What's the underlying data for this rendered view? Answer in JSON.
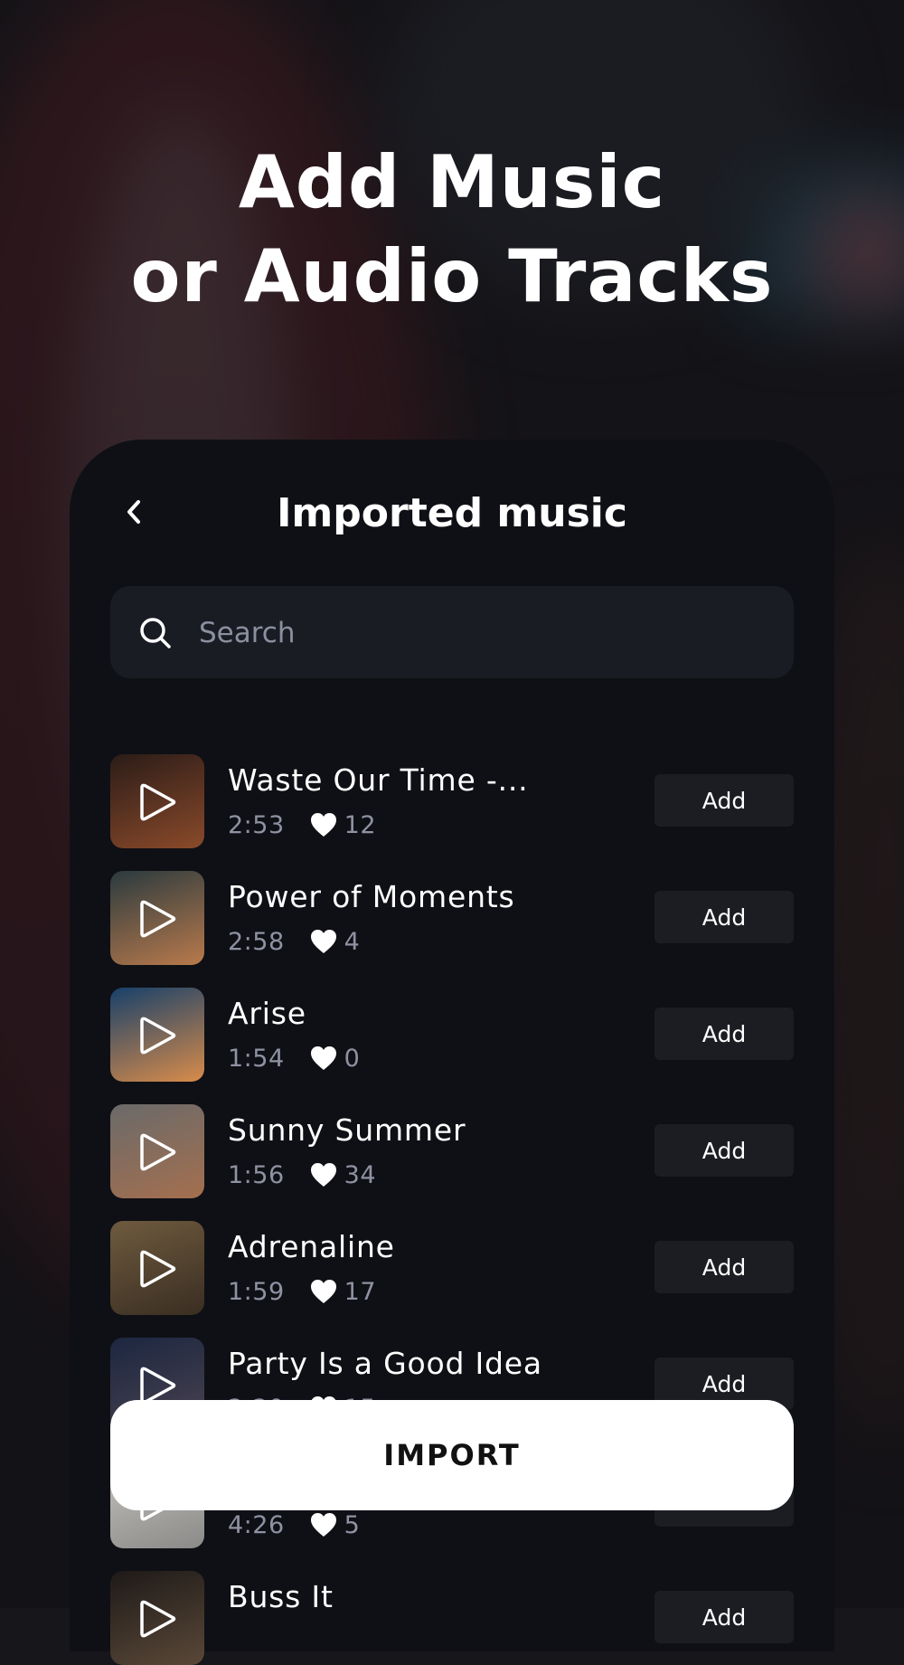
{
  "headline": {
    "line1": "Add Music",
    "line2": "or Audio Tracks"
  },
  "panel": {
    "title": "Imported music",
    "back_icon": "chevron-left-icon",
    "search": {
      "placeholder": "Search",
      "value": "",
      "icon": "search-icon"
    }
  },
  "tracks": [
    {
      "name": "Waste Our Time -...",
      "duration": "2:53",
      "likes": "12",
      "thumb_colors": [
        "#2b1c18",
        "#8a4a2a"
      ],
      "add_label": "Add"
    },
    {
      "name": "Power of Moments",
      "duration": "2:58",
      "likes": "4",
      "thumb_colors": [
        "#2a3a3e",
        "#b97a4c"
      ],
      "add_label": "Add"
    },
    {
      "name": "Arise",
      "duration": "1:54",
      "likes": "0",
      "thumb_colors": [
        "#17406a",
        "#d98c4a"
      ],
      "add_label": "Add"
    },
    {
      "name": "Sunny Summer",
      "duration": "1:56",
      "likes": "34",
      "thumb_colors": [
        "#6a6a6a",
        "#a46f4e"
      ],
      "add_label": "Add"
    },
    {
      "name": "Adrenaline",
      "duration": "1:59",
      "likes": "17",
      "thumb_colors": [
        "#6e5a3e",
        "#3a2e22"
      ],
      "add_label": "Add"
    },
    {
      "name": "Party Is a Good Idea",
      "duration": "2:20",
      "likes": "15",
      "thumb_colors": [
        "#1c2740",
        "#4a4250"
      ],
      "add_label": "Add"
    },
    {
      "name": "",
      "duration": "4:26",
      "likes": "5",
      "thumb_colors": [
        "#c8c4c0",
        "#8a8a88"
      ],
      "add_label": "Add"
    },
    {
      "name": "Buss It",
      "duration": "",
      "likes": "",
      "thumb_colors": [
        "#1e1a18",
        "#5a4838"
      ],
      "add_label": "Add"
    }
  ],
  "import_button": {
    "label": "IMPORT"
  },
  "colors": {
    "panel": "#0f1015",
    "search_bg": "#1a1c24",
    "muted_text": "#8f92a2",
    "button_bg": "#1c1d22"
  }
}
